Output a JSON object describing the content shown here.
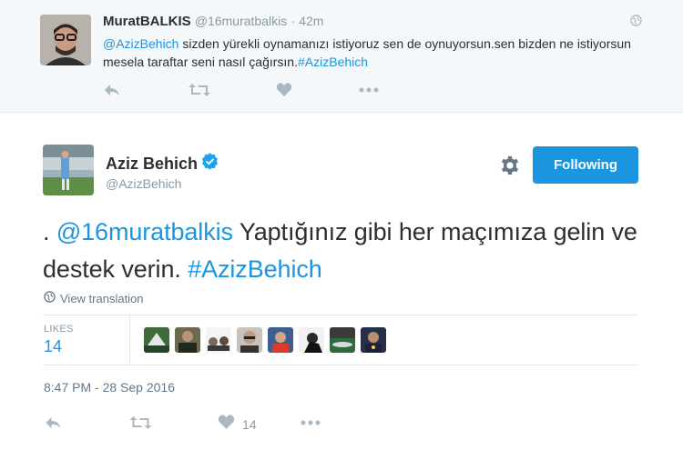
{
  "reply": {
    "name": "MuratBALKIS",
    "handle": "@16muratbalkis",
    "dot": "·",
    "time": "42m",
    "mention": "@AzizBehich",
    "text": " sizden yürekli oynamanızı istiyoruz sen de oynuyorsun.sen bizden ne istiyorsun mesela taraftar seni nasıl çağırsın.",
    "hashtag": "#AzizBehich",
    "actions": [
      "reply-icon",
      "retweet-icon",
      "like-icon",
      "more-icon"
    ]
  },
  "tweet": {
    "name": "Aziz Behich",
    "handle": "@AzizBehich",
    "follow_label": "Following",
    "prefix": ". ",
    "mention": "@16muratbalkis",
    "text": " Yaptığınız gibi her maçımıza gelin ve destek verin. ",
    "hashtag": "#AzizBehich",
    "view_translation": "View translation",
    "likes_label": "LIKES",
    "likes_count": "14",
    "timestamp": "8:47 PM - 28 Sep 2016",
    "like_action_count": "14"
  },
  "colors": {
    "accent": "#1b95e0",
    "verified": "#1da1f2",
    "muted": "#8899a6"
  }
}
